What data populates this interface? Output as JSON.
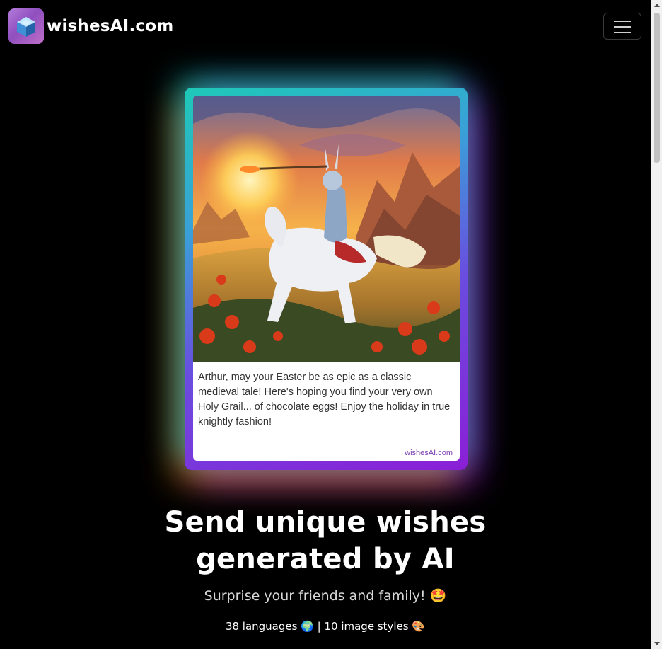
{
  "navbar": {
    "brand_name": "wishesAI.com",
    "logo_icon": "cube-icon",
    "toggler_icon": "hamburger-menu-icon"
  },
  "card": {
    "message": "Arthur, may your Easter be as epic as a classic medieval tale! Here's hoping you find your very own Holy Grail... of chocolate eggs! Enjoy the holiday in true knightly fashion!",
    "watermark": "wishesAI.com"
  },
  "hero": {
    "headline": "Send unique wishes generated by AI",
    "subheadline": "Surprise your friends and family! 🤩",
    "features": "38 languages 🌍 | 10 image styles 🎨"
  },
  "colors": {
    "background": "#000000",
    "text": "#ffffff",
    "accent_purple": "#8b1fd6",
    "accent_teal": "#1ec9b7",
    "accent_orange": "#ff961e"
  }
}
